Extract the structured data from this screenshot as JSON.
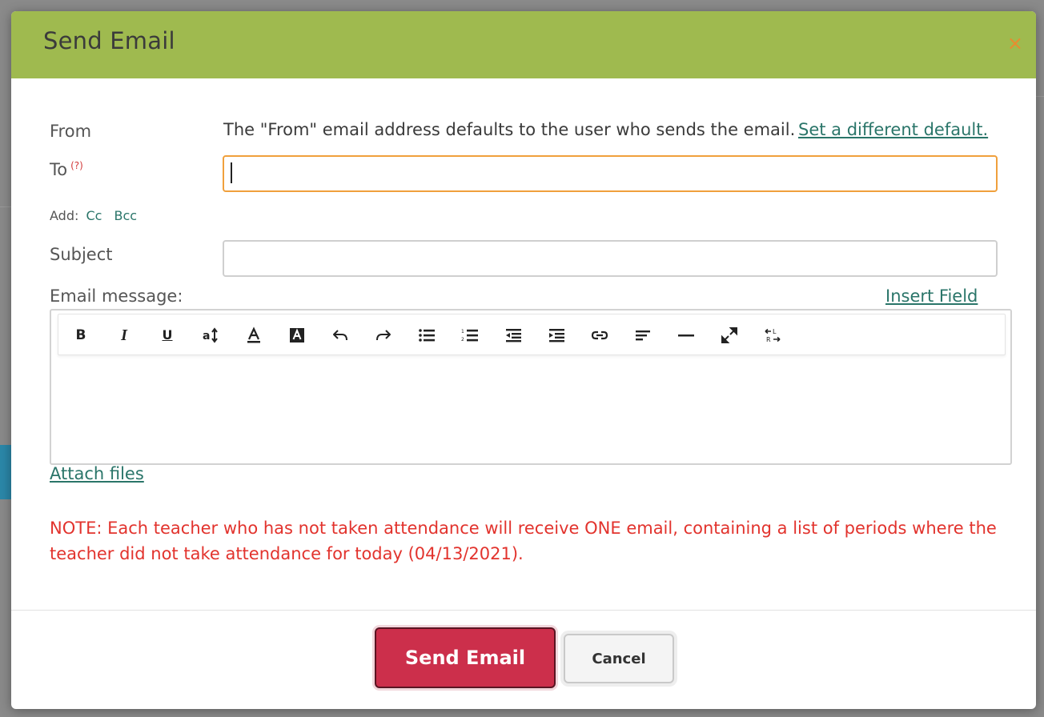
{
  "dialog": {
    "title": "Send Email",
    "close_symbol": "×",
    "accent_color": "#9fba4f"
  },
  "form": {
    "from_label": "From",
    "from_text": "The \"From\" email address defaults to the user who sends the email.",
    "from_link": "Set a different default.",
    "to_label": "To",
    "to_help": "(?)",
    "to_value": "",
    "add_label": "Add:",
    "cc_link": "Cc",
    "bcc_link": "Bcc",
    "subject_label": "Subject",
    "subject_value": "",
    "message_label": "Email message:",
    "insert_field_link": "Insert Field"
  },
  "toolbar": {
    "bold": "B",
    "italic": "I",
    "underline": "U",
    "icons": [
      "bold-icon",
      "italic-icon",
      "underline-icon",
      "font-size-icon",
      "text-color-icon",
      "background-color-icon",
      "undo-icon",
      "redo-icon",
      "bulleted-list-icon",
      "numbered-list-icon",
      "outdent-icon",
      "indent-icon",
      "link-icon",
      "align-icon",
      "horizontal-rule-icon",
      "fullscreen-icon",
      "text-direction-icon"
    ]
  },
  "attach_link": "Attach files",
  "note": "NOTE: Each teacher who has not taken attendance will receive ONE email, containing a list of periods where the teacher did not take attendance for today (04/13/2021).",
  "buttons": {
    "send": "Send Email",
    "cancel": "Cancel"
  },
  "colors": {
    "send_button": "#cc2f4b",
    "note_text": "#e2332d",
    "link": "#2a7569",
    "focus_border": "#f0a03c"
  }
}
